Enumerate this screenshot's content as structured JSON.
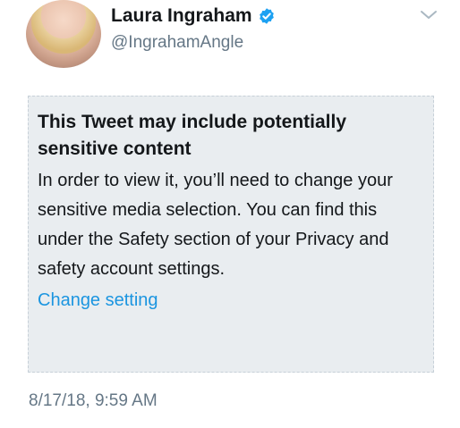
{
  "author": {
    "name": "Laura Ingraham",
    "handle": "@IngrahamAngle"
  },
  "notice": {
    "title": "This Tweet may include potentially sensitive content",
    "body": "In order to view it, you’ll need to change your sensitive media selection. You can find this under the Safety section of your Privacy and safety account settings.",
    "link_label": "Change setting"
  },
  "timestamp": "8/17/18, 9:59 AM",
  "icons": {
    "verified": "verified-badge-icon",
    "menu": "chevron-down-icon"
  },
  "colors": {
    "link": "#1b95e0",
    "verified": "#1da1f2",
    "muted": "#657786",
    "notice_bg": "#e9edf0"
  }
}
